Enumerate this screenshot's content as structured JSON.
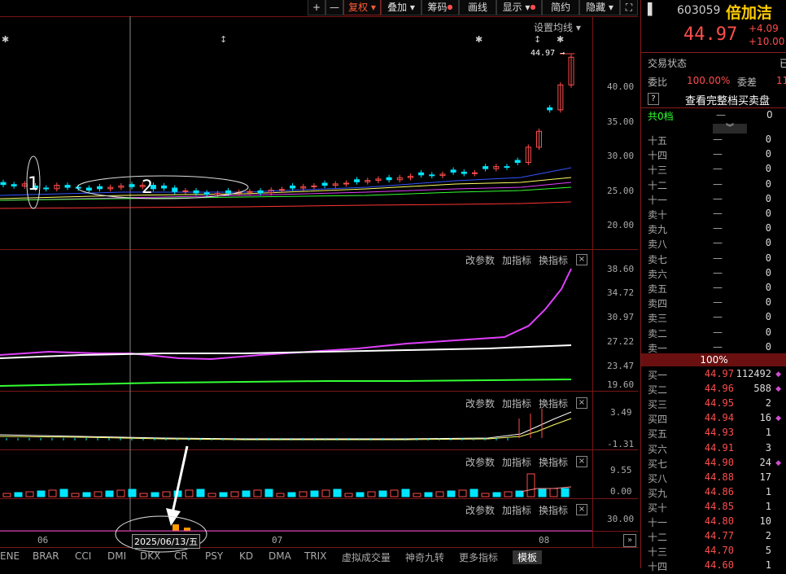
{
  "toolbar": {
    "plus": "+",
    "minus": "—",
    "fuquan": "复权",
    "diejia": "叠加",
    "chouma": "筹码",
    "huaxian": "画线",
    "xianshi": "显示",
    "jianyue": "简约",
    "yincang": "隐藏",
    "fullscreen_icon": "expand-icon"
  },
  "main_pane": {
    "settings_label": "设置均线",
    "last_price_tag": "44.97",
    "y_ticks": [
      "40.00",
      "35.00",
      "30.00",
      "25.00",
      "20.00"
    ],
    "annotations": [
      "1",
      "2"
    ]
  },
  "indicator_actions": {
    "change_params": "改参数",
    "add_indicator": "加指标",
    "switch_indicator": "换指标",
    "close": "×"
  },
  "pane2_ticks": [
    "38.60",
    "34.72",
    "30.97",
    "27.22",
    "23.47",
    "19.60"
  ],
  "pane3_ticks": [
    "3.49",
    "-1.31"
  ],
  "pane4_ticks": [
    "9.55",
    "0.00"
  ],
  "pane5_ticks": [
    "30.00"
  ],
  "x_axis": {
    "labels": [
      "06",
      "07",
      "08"
    ],
    "cursor_date": "2025/06/13/五"
  },
  "bottom_tabs": [
    "ENE",
    "BRAR",
    "CCI",
    "DMI",
    "DKX",
    "CR",
    "PSY",
    "KD",
    "DMA",
    "TRIX",
    "虚拟成交量",
    "神奇九转",
    "更多指标",
    "模板"
  ],
  "quote": {
    "code": "603059",
    "name": "倍加洁",
    "price": "44.97",
    "change": "+4.09",
    "change_pct": "+10.00",
    "trade_status_label": "交易状态",
    "trade_status_value": "已",
    "weibi_label": "委比",
    "weibi_value": "100.00%",
    "weicha_label": "委差",
    "weicha_value": "11",
    "full_book_q": "?",
    "full_book_label": "查看完整档买卖盘",
    "total_label": "共0档",
    "total_dash": "—",
    "total_value": "0",
    "ratio": "100%"
  },
  "sell_levels": [
    {
      "label": "十五",
      "price": "—",
      "vol": "0"
    },
    {
      "label": "十四",
      "price": "—",
      "vol": "0"
    },
    {
      "label": "十三",
      "price": "—",
      "vol": "0"
    },
    {
      "label": "十二",
      "price": "—",
      "vol": "0"
    },
    {
      "label": "十一",
      "price": "—",
      "vol": "0"
    },
    {
      "label": "卖十",
      "price": "—",
      "vol": "0"
    },
    {
      "label": "卖九",
      "price": "—",
      "vol": "0"
    },
    {
      "label": "卖八",
      "price": "—",
      "vol": "0"
    },
    {
      "label": "卖七",
      "price": "—",
      "vol": "0"
    },
    {
      "label": "卖六",
      "price": "—",
      "vol": "0"
    },
    {
      "label": "卖五",
      "price": "—",
      "vol": "0"
    },
    {
      "label": "卖四",
      "price": "—",
      "vol": "0"
    },
    {
      "label": "卖三",
      "price": "—",
      "vol": "0"
    },
    {
      "label": "卖二",
      "price": "—",
      "vol": "0"
    },
    {
      "label": "卖一",
      "price": "—",
      "vol": "0"
    }
  ],
  "buy_levels": [
    {
      "label": "买一",
      "price": "44.97",
      "vol": "112492",
      "dot": "◆"
    },
    {
      "label": "买二",
      "price": "44.96",
      "vol": "588",
      "dot": "◆"
    },
    {
      "label": "买三",
      "price": "44.95",
      "vol": "2",
      "dot": ""
    },
    {
      "label": "买四",
      "price": "44.94",
      "vol": "16",
      "dot": "◆"
    },
    {
      "label": "买五",
      "price": "44.93",
      "vol": "1",
      "dot": ""
    },
    {
      "label": "买六",
      "price": "44.91",
      "vol": "3",
      "dot": ""
    },
    {
      "label": "买七",
      "price": "44.90",
      "vol": "24",
      "dot": "◆"
    },
    {
      "label": "买八",
      "price": "44.88",
      "vol": "17",
      "dot": ""
    },
    {
      "label": "买九",
      "price": "44.86",
      "vol": "1",
      "dot": ""
    },
    {
      "label": "买十",
      "price": "44.85",
      "vol": "1",
      "dot": ""
    },
    {
      "label": "十一",
      "price": "44.80",
      "vol": "10",
      "dot": ""
    },
    {
      "label": "十二",
      "price": "44.77",
      "vol": "2",
      "dot": ""
    },
    {
      "label": "十三",
      "price": "44.70",
      "vol": "5",
      "dot": ""
    },
    {
      "label": "十四",
      "price": "44.60",
      "vol": "1",
      "dot": ""
    }
  ],
  "colors": {
    "up": "#ff4d4d",
    "down": "#00e5ff",
    "border": "#8a1d1d",
    "ma_white": "#ffffff",
    "ma_yellow": "#ffff66",
    "ma_magenta": "#e040fb",
    "ma_green": "#33ff33",
    "ma_blue": "#3355ff",
    "ma_red": "#ff3333"
  }
}
